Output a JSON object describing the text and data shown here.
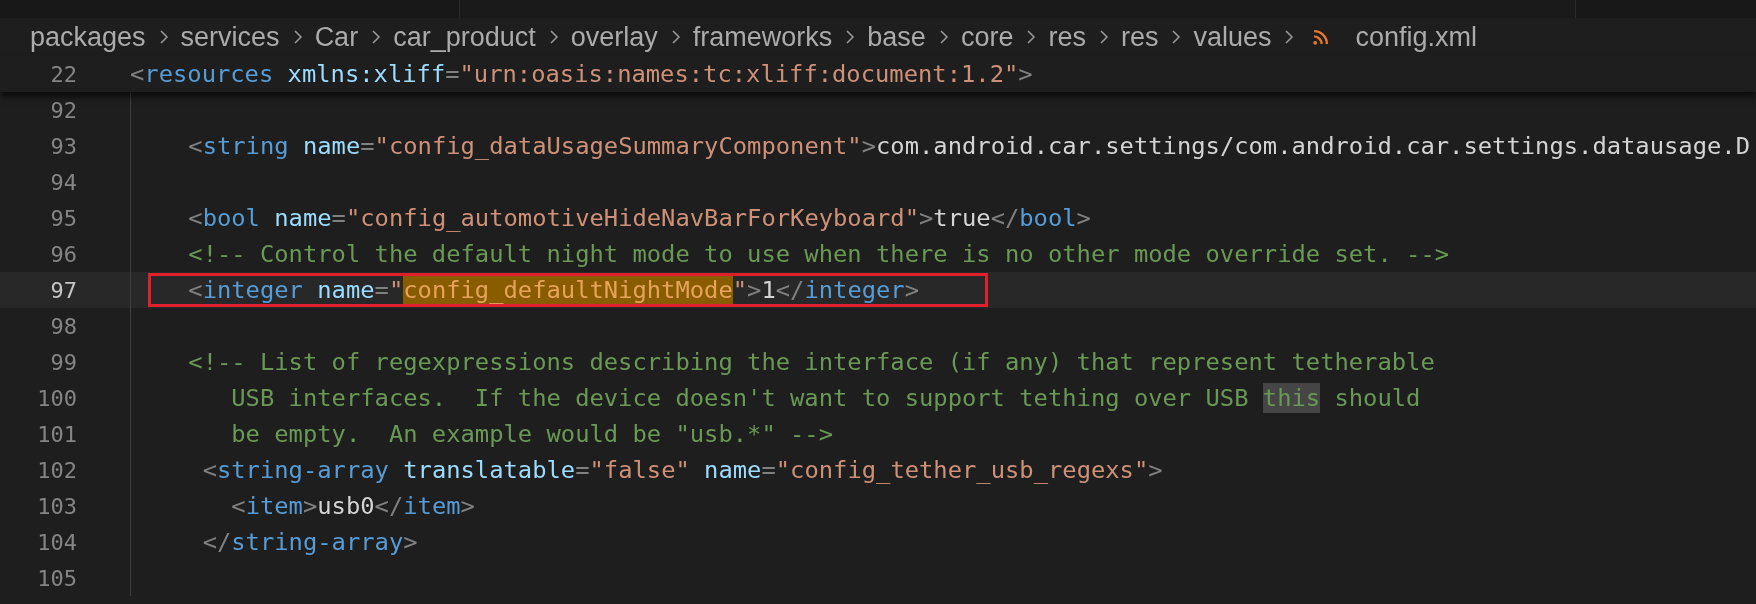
{
  "breadcrumbs": [
    "packages",
    "services",
    "Car",
    "car_product",
    "overlay",
    "frameworks",
    "base",
    "core",
    "res",
    "res",
    "values"
  ],
  "file": {
    "name": "config.xml"
  },
  "sticky_line": {
    "number": "22",
    "tokens": [
      {
        "kind": "punct",
        "text": "<"
      },
      {
        "kind": "tag",
        "text": "resources"
      },
      {
        "kind": "attr",
        "text": " xmlns:xliff"
      },
      {
        "kind": "punct",
        "text": "="
      },
      {
        "kind": "string",
        "text": "\"urn:oasis:names:tc:xliff:document:1.2\""
      },
      {
        "kind": "punct",
        "text": ">"
      }
    ]
  },
  "lines": [
    {
      "number": "92",
      "current": false,
      "boxed": false
    },
    {
      "number": "93",
      "current": false,
      "boxed": false,
      "tokens": [
        {
          "kind": "punct",
          "text": "    <"
        },
        {
          "kind": "tag",
          "text": "string"
        },
        {
          "kind": "attr",
          "text": " name"
        },
        {
          "kind": "punct",
          "text": "="
        },
        {
          "kind": "string",
          "text": "\"config_dataUsageSummaryComponent\""
        },
        {
          "kind": "punct",
          "text": ">"
        },
        {
          "kind": "text",
          "text": "com.android.car.settings/com.android.car.settings.datausage.D"
        }
      ]
    },
    {
      "number": "94",
      "current": false,
      "boxed": false
    },
    {
      "number": "95",
      "current": false,
      "boxed": false,
      "tokens": [
        {
          "kind": "punct",
          "text": "    <"
        },
        {
          "kind": "tag",
          "text": "bool"
        },
        {
          "kind": "attr",
          "text": " name"
        },
        {
          "kind": "punct",
          "text": "="
        },
        {
          "kind": "string",
          "text": "\"config_automotiveHideNavBarForKeyboard\""
        },
        {
          "kind": "punct",
          "text": ">"
        },
        {
          "kind": "text",
          "text": "true"
        },
        {
          "kind": "punct",
          "text": "</"
        },
        {
          "kind": "tag",
          "text": "bool"
        },
        {
          "kind": "punct",
          "text": ">"
        }
      ]
    },
    {
      "number": "96",
      "current": false,
      "boxed": false,
      "tokens": [
        {
          "kind": "comment",
          "text": "    <!-- Control the default night mode to use when there is no other mode override set. -->"
        }
      ]
    },
    {
      "number": "97",
      "current": true,
      "boxed": true,
      "tokens": [
        {
          "kind": "punct",
          "text": "    <"
        },
        {
          "kind": "tag",
          "text": "integer"
        },
        {
          "kind": "attr",
          "text": " name"
        },
        {
          "kind": "punct",
          "text": "="
        },
        {
          "kind": "string",
          "text": "\""
        },
        {
          "kind": "string",
          "text": "config_defaultNightMode",
          "search_match": true
        },
        {
          "kind": "string",
          "text": "\""
        },
        {
          "kind": "punct",
          "text": ">"
        },
        {
          "kind": "text",
          "text": "1"
        },
        {
          "kind": "punct",
          "text": "</"
        },
        {
          "kind": "tag",
          "text": "integer"
        },
        {
          "kind": "punct",
          "text": ">"
        }
      ]
    },
    {
      "number": "98",
      "current": false,
      "boxed": false
    },
    {
      "number": "99",
      "current": false,
      "boxed": false,
      "tokens": [
        {
          "kind": "comment",
          "text": "    <!-- List of regexpressions describing the interface (if any) that represent tetherable"
        }
      ]
    },
    {
      "number": "100",
      "current": false,
      "boxed": false,
      "tokens": [
        {
          "kind": "comment",
          "text": "       USB interfaces.  If the device doesn't want to support tething over USB "
        },
        {
          "kind": "comment",
          "text": "this",
          "word_match": true
        },
        {
          "kind": "comment",
          "text": " should"
        }
      ]
    },
    {
      "number": "101",
      "current": false,
      "boxed": false,
      "tokens": [
        {
          "kind": "comment",
          "text": "       be empty.  An example would be \"usb.*\" -->"
        }
      ]
    },
    {
      "number": "102",
      "current": false,
      "boxed": false,
      "tokens": [
        {
          "kind": "punct",
          "text": "     <"
        },
        {
          "kind": "tag",
          "text": "string-array"
        },
        {
          "kind": "attr",
          "text": " translatable"
        },
        {
          "kind": "punct",
          "text": "="
        },
        {
          "kind": "string",
          "text": "\"false\""
        },
        {
          "kind": "attr",
          "text": " name"
        },
        {
          "kind": "punct",
          "text": "="
        },
        {
          "kind": "string",
          "text": "\"config_tether_usb_regexs\""
        },
        {
          "kind": "punct",
          "text": ">"
        }
      ]
    },
    {
      "number": "103",
      "current": false,
      "boxed": false,
      "tokens": [
        {
          "kind": "punct",
          "text": "       <"
        },
        {
          "kind": "tag",
          "text": "item"
        },
        {
          "kind": "punct",
          "text": ">"
        },
        {
          "kind": "text",
          "text": "usb0"
        },
        {
          "kind": "punct",
          "text": "</"
        },
        {
          "kind": "tag",
          "text": "item"
        },
        {
          "kind": "punct",
          "text": ">"
        }
      ]
    },
    {
      "number": "104",
      "current": false,
      "boxed": false,
      "tokens": [
        {
          "kind": "punct",
          "text": "     </"
        },
        {
          "kind": "tag",
          "text": "string-array"
        },
        {
          "kind": "punct",
          "text": ">"
        }
      ]
    },
    {
      "number": "105",
      "current": false,
      "boxed": false
    }
  ]
}
